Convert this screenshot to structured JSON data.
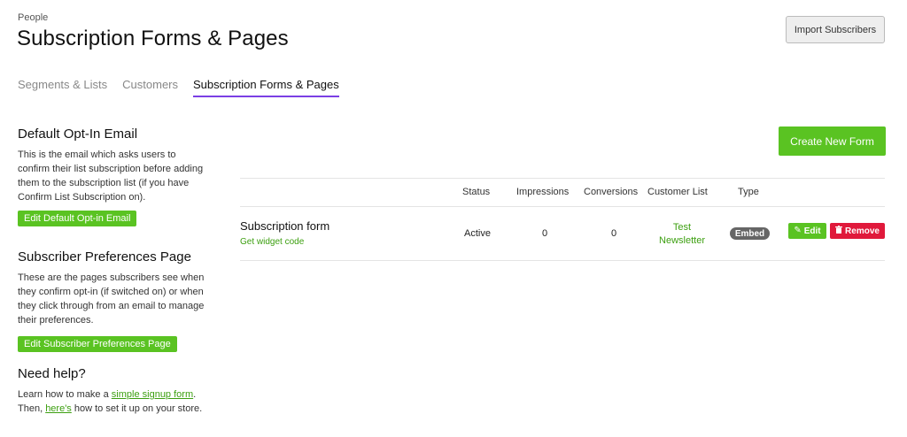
{
  "header": {
    "eyebrow": "People",
    "title": "Subscription Forms & Pages",
    "import_label": "Import Subscribers"
  },
  "tabs": [
    {
      "label": "Segments & Lists",
      "active": false
    },
    {
      "label": "Customers",
      "active": false
    },
    {
      "label": "Subscription Forms & Pages",
      "active": true
    }
  ],
  "sidebar": {
    "optin": {
      "heading": "Default Opt-In Email",
      "text": "This is the email which asks users to confirm their list subscription before adding them to the subscription list (if you have Confirm List Subscription on).",
      "button": "Edit Default Opt-in Email"
    },
    "prefs": {
      "heading": "Subscriber Preferences Page",
      "text": "These are the pages subscribers see when they confirm opt-in (if switched on) or when they click through from an email to manage their preferences.",
      "button": "Edit Subscriber Preferences Page"
    },
    "help": {
      "heading": "Need help?",
      "text1": "Learn how to make a ",
      "link1": "simple signup form",
      "text2": ". Then, ",
      "link2": "here's",
      "text3": " how to set it up on your store."
    }
  },
  "main": {
    "create_label": "Create New Form",
    "columns": [
      "Status",
      "Impressions",
      "Conversions",
      "Customer List",
      "Type"
    ],
    "rows": [
      {
        "name": "Subscription form",
        "widget_link": "Get widget code",
        "status": "Active",
        "impressions": "0",
        "conversions": "0",
        "customer_list_line1": "Test",
        "customer_list_line2": "Newsletter",
        "type": "Embed",
        "edit_label": "Edit",
        "remove_label": "Remove"
      }
    ]
  },
  "colors": {
    "accent_green": "#5ac322",
    "tab_underline": "#7b3fe4",
    "danger": "#e0193b"
  },
  "icons": {
    "edit": "pencil-icon",
    "remove": "trash-icon"
  }
}
